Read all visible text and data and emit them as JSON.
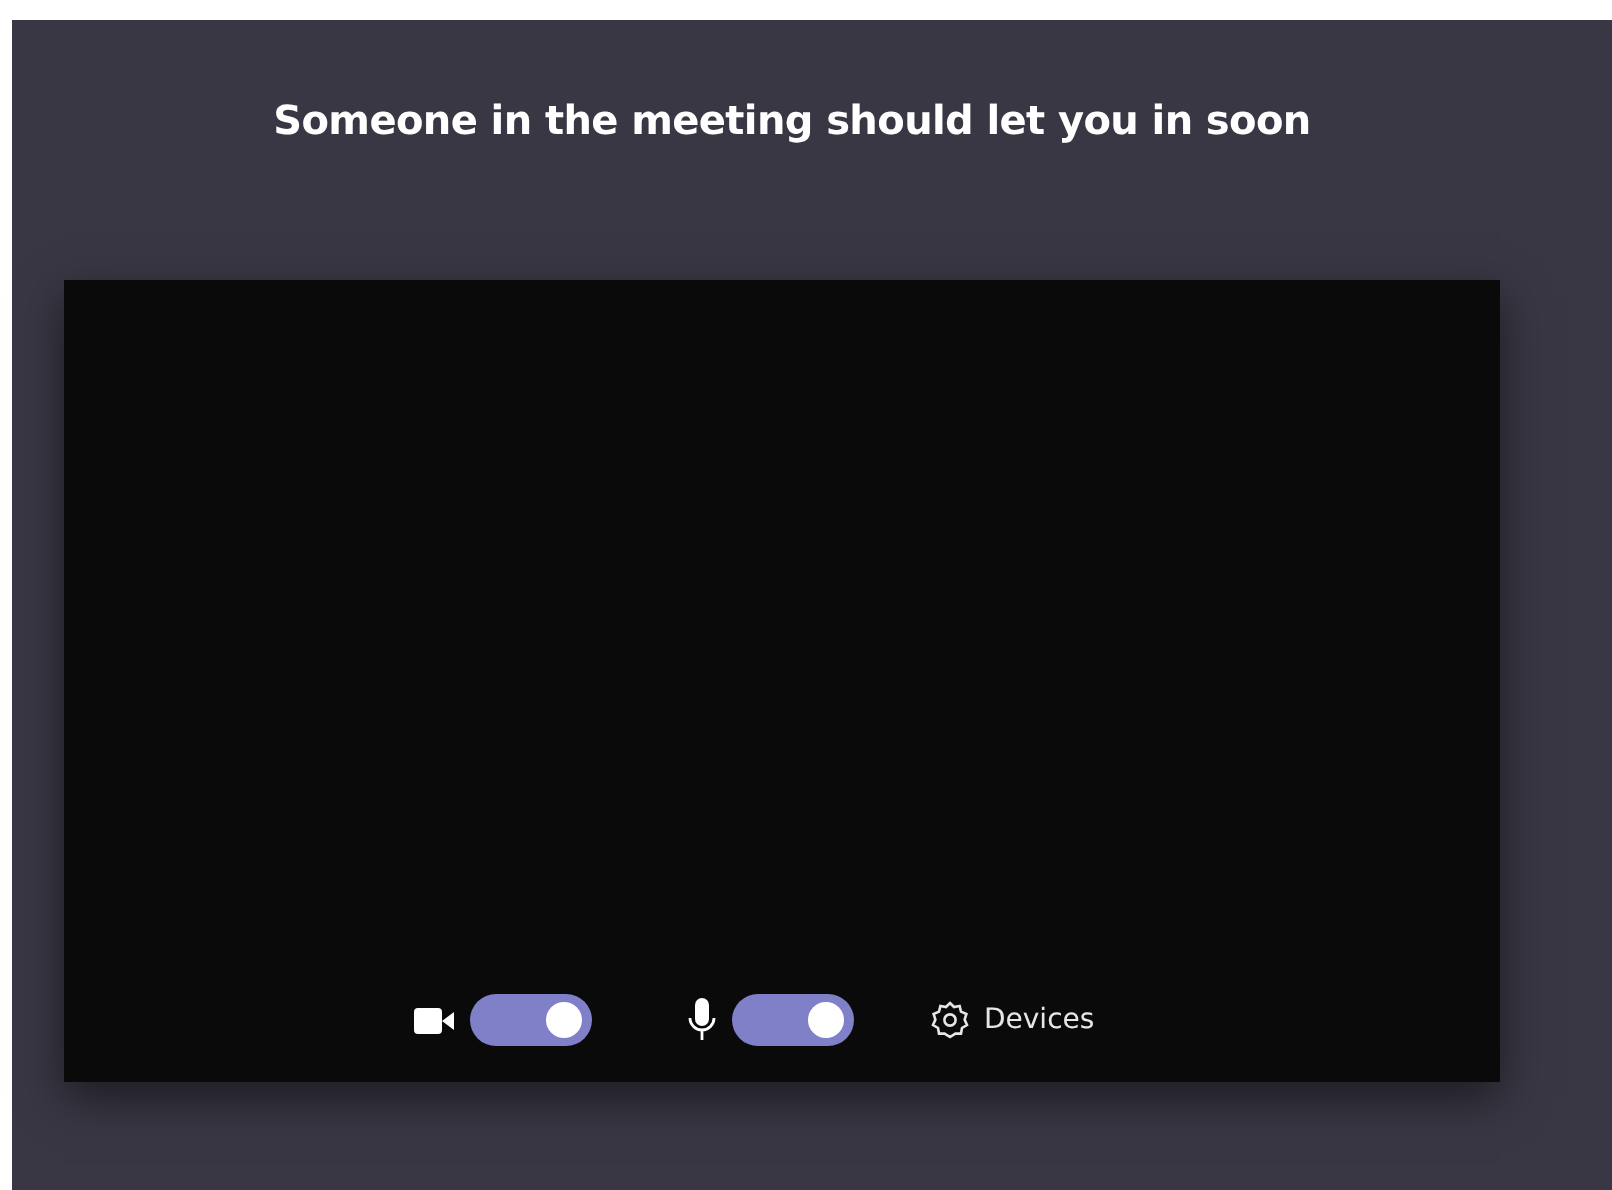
{
  "title": "Someone in the meeting should let you in soon",
  "controls": {
    "camera": {
      "on": true
    },
    "microphone": {
      "on": true
    },
    "devices": {
      "label": "Devices"
    }
  }
}
